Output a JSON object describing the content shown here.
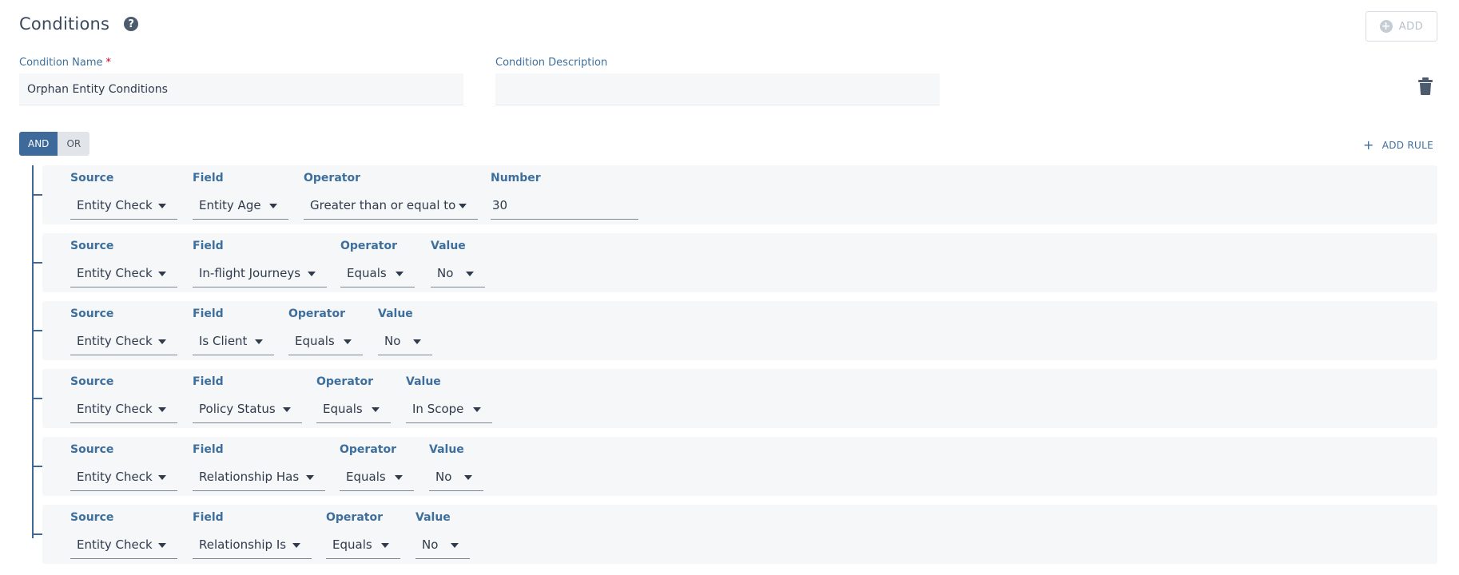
{
  "header": {
    "title": "Conditions",
    "help_icon": "?"
  },
  "add_button": {
    "label": "ADD",
    "icon": "plus-circle-icon"
  },
  "condition_name": {
    "label": "Condition Name",
    "required_marker": "*",
    "value": "Orphan Entity Conditions"
  },
  "condition_description": {
    "label": "Condition Description",
    "value": ""
  },
  "logic_toggle": {
    "and_label": "AND",
    "or_label": "OR",
    "selected": "AND"
  },
  "add_rule": {
    "label": "ADD RULE",
    "icon": "+"
  },
  "colors": {
    "accent": "#3d6a9b",
    "label": "#3e6f9c",
    "panel": "#f5f7f9"
  },
  "rules": [
    {
      "source_label": "Source",
      "source": "Entity Check",
      "field_label": "Field",
      "field": "Entity Age",
      "operator_label": "Operator",
      "operator": "Greater than or equal to",
      "value_label": "Number",
      "value": "30"
    },
    {
      "source_label": "Source",
      "source": "Entity Check",
      "field_label": "Field",
      "field": "In-flight Journeys",
      "operator_label": "Operator",
      "operator": "Equals",
      "value_label": "Value",
      "value": "No"
    },
    {
      "source_label": "Source",
      "source": "Entity Check",
      "field_label": "Field",
      "field": "Is Client",
      "operator_label": "Operator",
      "operator": "Equals",
      "value_label": "Value",
      "value": "No"
    },
    {
      "source_label": "Source",
      "source": "Entity Check",
      "field_label": "Field",
      "field": "Policy Status",
      "operator_label": "Operator",
      "operator": "Equals",
      "value_label": "Value",
      "value": "In Scope"
    },
    {
      "source_label": "Source",
      "source": "Entity Check",
      "field_label": "Field",
      "field": "Relationship Has",
      "operator_label": "Operator",
      "operator": "Equals",
      "value_label": "Value",
      "value": "No"
    },
    {
      "source_label": "Source",
      "source": "Entity Check",
      "field_label": "Field",
      "field": "Relationship Is",
      "operator_label": "Operator",
      "operator": "Equals",
      "value_label": "Value",
      "value": "No"
    }
  ]
}
